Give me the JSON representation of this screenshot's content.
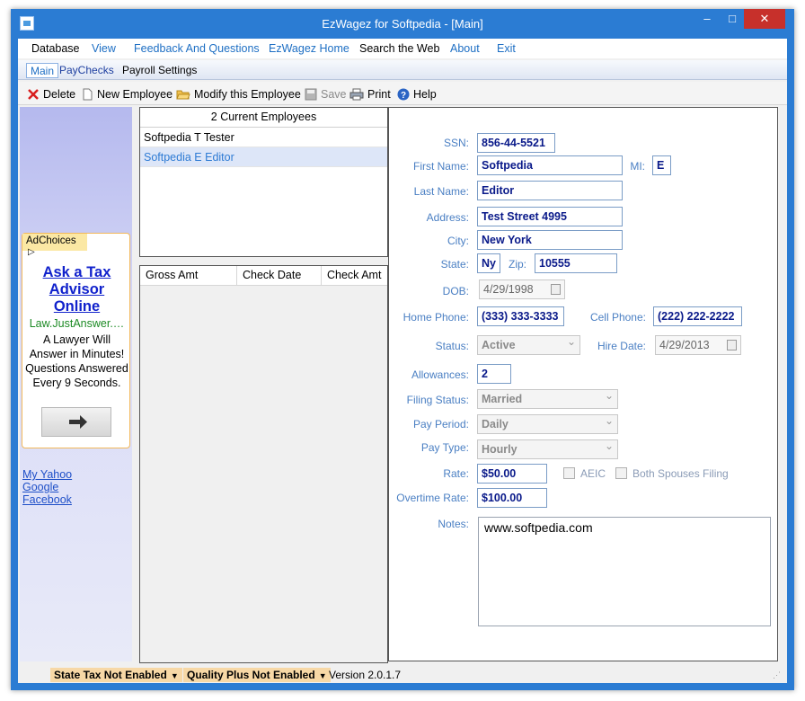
{
  "window": {
    "title": "EzWagez for Softpedia - [Main]",
    "controls": {
      "minimize": "–",
      "maximize": "□",
      "close": "✕"
    }
  },
  "menu": {
    "items": [
      "Database",
      "View",
      "Feedback And Questions",
      "EzWagez Home",
      "Search the Web",
      "About",
      "Exit"
    ]
  },
  "tabs": {
    "items": [
      "Main",
      "PayChecks",
      "Payroll Settings"
    ]
  },
  "toolbar": {
    "delete": "Delete",
    "new_employee": "New Employee",
    "modify": "Modify this Employee",
    "save": "Save",
    "print": "Print",
    "help": "Help"
  },
  "sidebar": {
    "ad": {
      "adchoices": "AdChoices",
      "title": "Ask a Tax Advisor Online",
      "url": "Law.JustAnswer.…",
      "body": "A Lawyer Will Answer in Minutes! Questions Answered Every 9 Seconds."
    },
    "links": [
      "My Yahoo",
      "Google",
      "Facebook"
    ]
  },
  "employees": {
    "header": "2 Current Employees",
    "list": [
      "Softpedia T Tester",
      "Softpedia E Editor"
    ]
  },
  "checks": {
    "columns": [
      "Gross Amt",
      "Check Date",
      "Check Amt"
    ]
  },
  "form": {
    "ssn": {
      "label": "SSN:",
      "value": "856-44-5521"
    },
    "first_name": {
      "label": "First Name:",
      "value": "Softpedia"
    },
    "mi": {
      "label": "MI:",
      "value": "E"
    },
    "last_name": {
      "label": "Last Name:",
      "value": "Editor"
    },
    "address": {
      "label": "Address:",
      "value": "Test Street 4995"
    },
    "city": {
      "label": "City:",
      "value": "New York"
    },
    "state": {
      "label": "State:",
      "value": "Ny"
    },
    "zip": {
      "label": "Zip:",
      "value": "10555"
    },
    "dob": {
      "label": "DOB:",
      "value": "4/29/1998"
    },
    "home_phone": {
      "label": "Home Phone:",
      "value": "(333) 333-3333"
    },
    "cell_phone": {
      "label": "Cell Phone:",
      "value": "(222) 222-2222"
    },
    "status": {
      "label": "Status:",
      "value": "Active"
    },
    "hire_date": {
      "label": "Hire Date:",
      "value": "4/29/2013"
    },
    "allowances": {
      "label": "Allowances:",
      "value": "2"
    },
    "filing_status": {
      "label": "Filing Status:",
      "value": "Married"
    },
    "pay_period": {
      "label": "Pay Period:",
      "value": "Daily"
    },
    "pay_type": {
      "label": "Pay Type:",
      "value": "Hourly"
    },
    "rate": {
      "label": "Rate:",
      "value": "$50.00"
    },
    "aeic": {
      "label": "AEIC"
    },
    "both_spouses": {
      "label": "Both Spouses Filing"
    },
    "overtime_rate": {
      "label": "Overtime Rate:",
      "value": "$100.00"
    },
    "notes": {
      "label": "Notes:",
      "value": "www.softpedia.com"
    }
  },
  "statusbar": {
    "state_tax": "State Tax Not Enabled",
    "quality_plus": "Quality Plus Not Enabled",
    "version": "Version 2.0.1.7"
  },
  "colors": {
    "title_bar": "#2b7cd3",
    "close_button": "#c7302b",
    "field_text": "#0a1a8a",
    "label_text": "#4a7fc3",
    "selected_row": "#dde6f8"
  }
}
